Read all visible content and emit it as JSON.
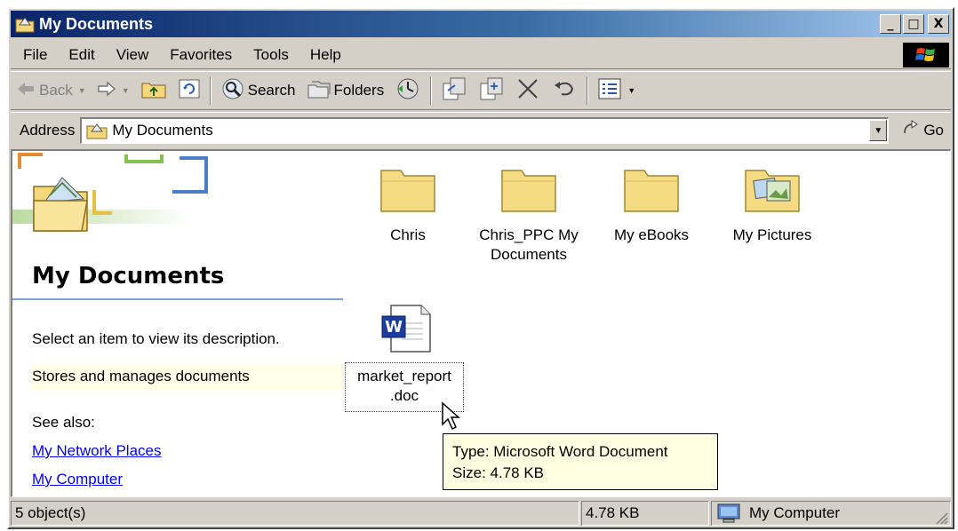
{
  "window": {
    "title": "My Documents",
    "controls": {
      "minimize": "_",
      "maximize": "□",
      "close": "X"
    }
  },
  "menu": [
    "File",
    "Edit",
    "View",
    "Favorites",
    "Tools",
    "Help"
  ],
  "toolbar": {
    "back": "Back",
    "search": "Search",
    "folders": "Folders"
  },
  "address": {
    "label": "Address",
    "value": "My Documents",
    "go": "Go"
  },
  "left_pane": {
    "title": "My Documents",
    "description": "Select an item to view its description.",
    "info": "Stores and manages documents",
    "see_also": "See also:",
    "links": [
      "My Network Places",
      "My Computer"
    ]
  },
  "files": [
    {
      "name": "Chris",
      "icon": "folder-icon"
    },
    {
      "name": "Chris_PPC My Documents",
      "icon": "folder-icon"
    },
    {
      "name": "My eBooks",
      "icon": "folder-icon"
    },
    {
      "name": "My Pictures",
      "icon": "pictures-folder-icon"
    }
  ],
  "selected_file": {
    "name_line1": "market_report",
    "name_line2": ".doc",
    "icon": "word-document-icon"
  },
  "tooltip": {
    "type": "Type: Microsoft Word Document",
    "size": "Size: 4.78 KB"
  },
  "status": {
    "objects": "5 object(s)",
    "size": "4.78 KB",
    "zone": "My Computer"
  },
  "colors": {
    "titlebar_start": "#0a246a",
    "titlebar_end": "#a6caf0",
    "chrome": "#d4d0c8",
    "link": "#0000ff",
    "tooltip_bg": "#ffffe1"
  }
}
